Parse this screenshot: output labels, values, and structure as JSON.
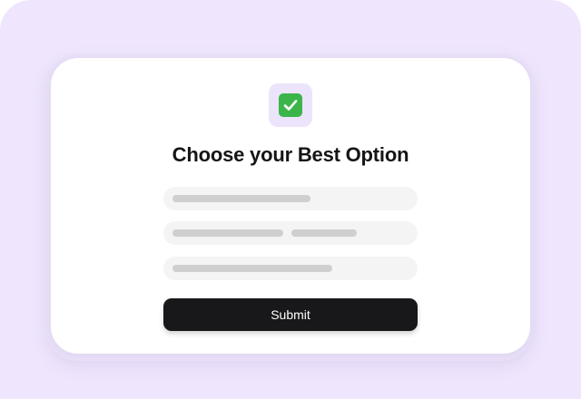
{
  "form": {
    "icon": "checkmark-icon",
    "title": "Choose your Best Option",
    "options": [
      {
        "icon": "placeholder-bar"
      },
      {
        "icon": "placeholder-bar"
      },
      {
        "icon": "placeholder-bar"
      }
    ],
    "submit_label": "Submit"
  },
  "colors": {
    "background": "#efe6fd",
    "card": "#ffffff",
    "accent_check": "#3bb54a",
    "button": "#18181a",
    "option_bg": "#f4f4f4",
    "placeholder_bar": "#cfcfcf"
  }
}
